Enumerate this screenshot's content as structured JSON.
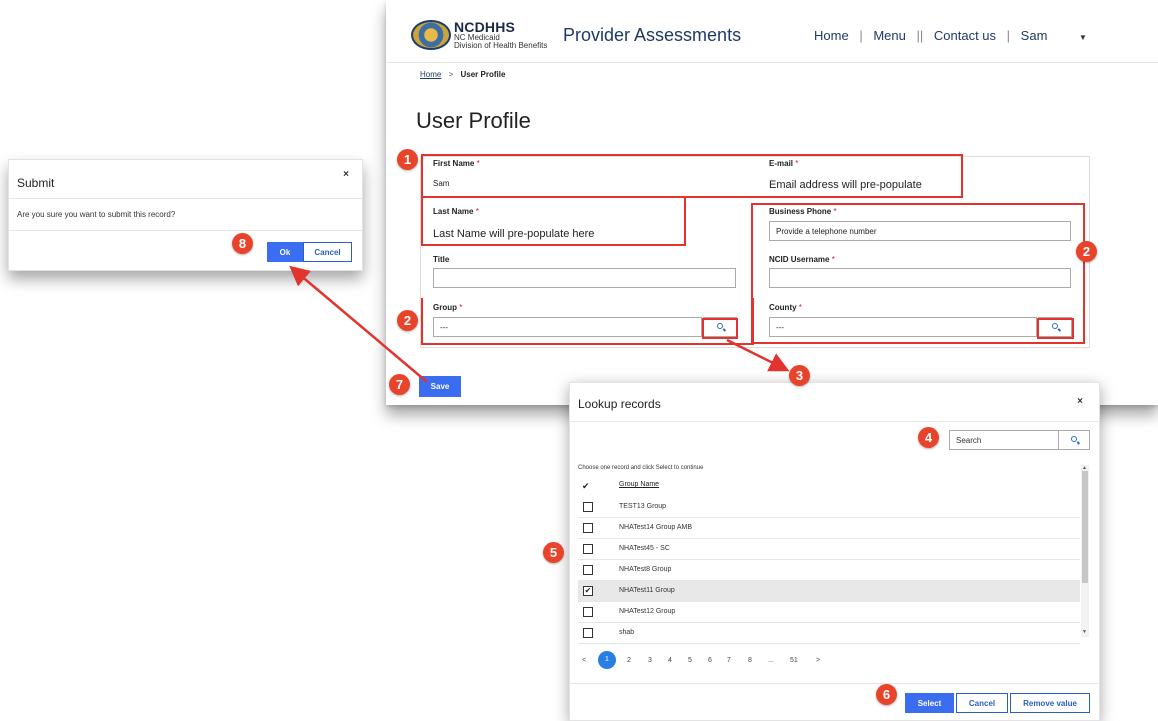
{
  "main": {
    "brand": "NCDHHS",
    "brand_sub1": "NC Medicaid",
    "brand_sub2": "Division of Health Benefits",
    "app_title": "Provider Assessments",
    "nav": {
      "home": "Home",
      "menu": "Menu",
      "contact": "Contact us",
      "user": "Sam"
    },
    "breadcrumb": {
      "home": "Home",
      "current": "User Profile"
    },
    "page_title": "User Profile",
    "fields": {
      "first_name": {
        "label": "First Name",
        "value": "Sam"
      },
      "email": {
        "label": "E-mail",
        "value": "Email address will pre-populate"
      },
      "last_name": {
        "label": "Last Name",
        "value": "Last Name will pre-populate here"
      },
      "business_phone": {
        "label": "Business Phone",
        "value": "Provide a telephone number"
      },
      "title": {
        "label": "Title",
        "value": ""
      },
      "ncid_username": {
        "label": "NCID Username",
        "value": ""
      },
      "group": {
        "label": "Group",
        "value": "---"
      },
      "county": {
        "label": "County",
        "value": "---"
      }
    },
    "required_mark": "*",
    "save_label": "Save"
  },
  "submit_dialog": {
    "title": "Submit",
    "close": "×",
    "message": "Are you sure you want to submit this record?",
    "ok_label": "Ok",
    "cancel_label": "Cancel"
  },
  "lookup_dialog": {
    "title": "Lookup records",
    "close": "×",
    "search_placeholder": "Search",
    "instruction": "Choose one record and click Select to continue",
    "check_header": "✔",
    "column_header": "Group Name",
    "rows": [
      {
        "name": "TEST13 Group",
        "checked": false
      },
      {
        "name": "NHATest14 Group AMB",
        "checked": false
      },
      {
        "name": "NHATest45 - SC",
        "checked": false
      },
      {
        "name": "NHATest8 Group",
        "checked": false
      },
      {
        "name": "NHATest11 Group",
        "checked": true
      },
      {
        "name": "NHATest12 Group",
        "checked": false
      },
      {
        "name": "shab",
        "checked": false
      }
    ],
    "pagination": [
      "<",
      "1",
      "2",
      "3",
      "4",
      "5",
      "6",
      "7",
      "8",
      "...",
      "51",
      ">"
    ],
    "current_page": "1",
    "select_label": "Select",
    "cancel_label": "Cancel",
    "remove_label": "Remove value"
  },
  "annotations": [
    "1",
    "2",
    "2",
    "3",
    "4",
    "5",
    "6",
    "7",
    "8"
  ],
  "colors": {
    "accent": "#3a6df0",
    "annotation": "#e8442c",
    "brand": "#1e3a64"
  }
}
